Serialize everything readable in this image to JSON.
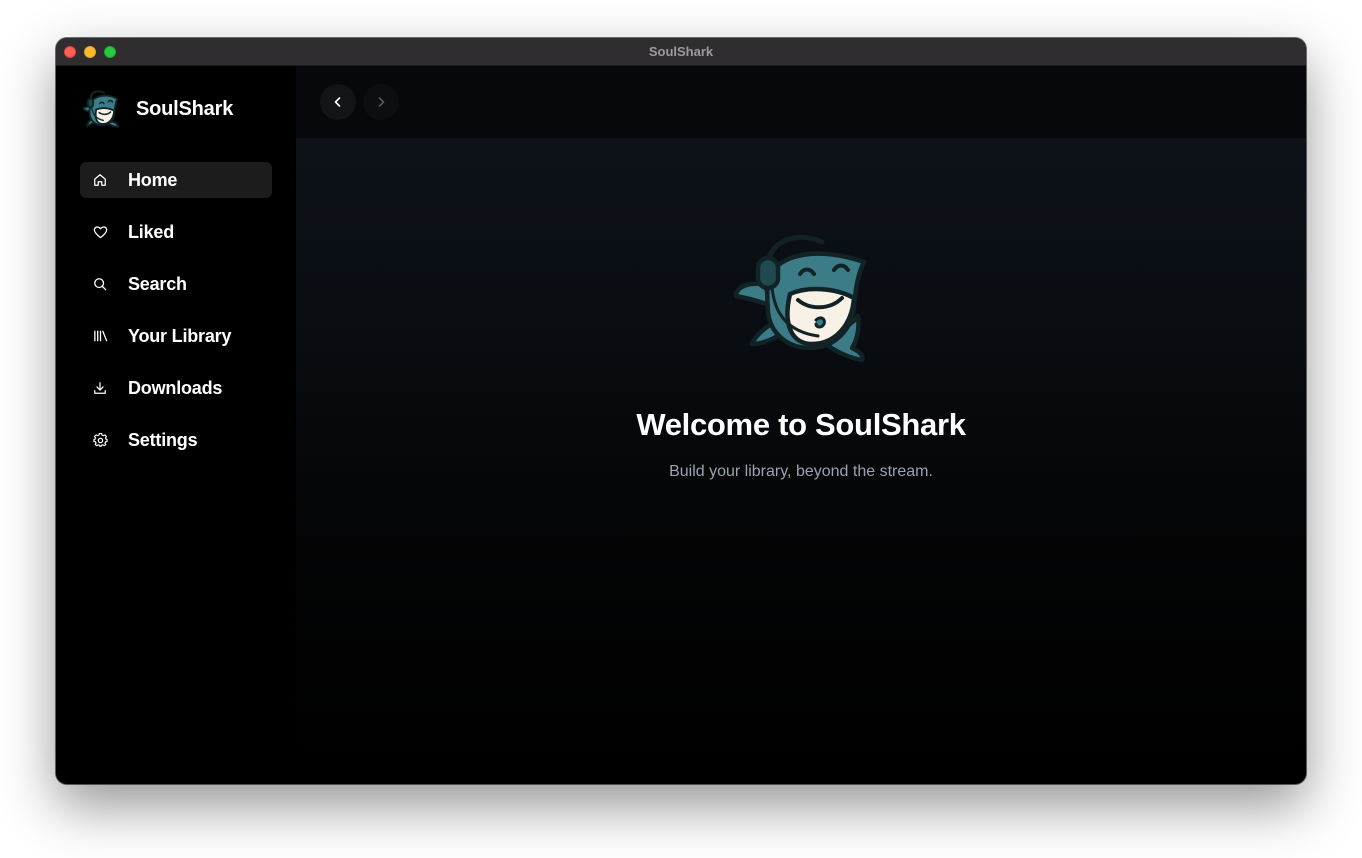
{
  "window": {
    "title": "SoulShark"
  },
  "sidebar": {
    "brand_name": "SoulShark",
    "brand_logo_icon": "shark-logo-icon",
    "items": [
      {
        "label": "Home",
        "icon": "home-icon",
        "active": true
      },
      {
        "label": "Liked",
        "icon": "heart-icon",
        "active": false
      },
      {
        "label": "Search",
        "icon": "search-icon",
        "active": false
      },
      {
        "label": "Your Library",
        "icon": "library-icon",
        "active": false
      },
      {
        "label": "Downloads",
        "icon": "download-icon",
        "active": false
      },
      {
        "label": "Settings",
        "icon": "gear-icon",
        "active": false
      }
    ]
  },
  "topbar": {
    "back_icon": "chevron-left-icon",
    "forward_icon": "chevron-right-icon",
    "forward_enabled": false
  },
  "hero": {
    "title": "Welcome to SoulShark",
    "subtitle": "Build your library, beyond the stream.",
    "logo_icon": "shark-headphones-icon"
  },
  "colors": {
    "accent_shark": "#3c7c86",
    "shark_belly": "#f7f1e6",
    "outline": "#112326"
  }
}
